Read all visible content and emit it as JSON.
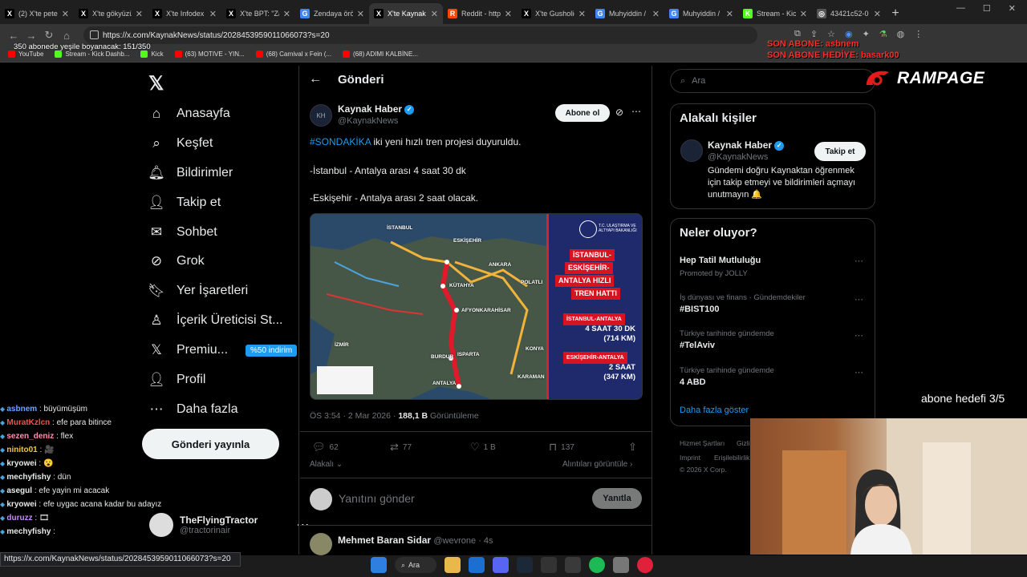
{
  "browser": {
    "tabs": [
      {
        "label": "(2) X'te peter",
        "fav": "X",
        "color": "#000000"
      },
      {
        "label": "X'te gökyüzü",
        "fav": "X",
        "color": "#000000"
      },
      {
        "label": "X'te Infodex",
        "fav": "X",
        "color": "#000000"
      },
      {
        "label": "X'te BPT: \"Za",
        "fav": "X",
        "color": "#000000"
      },
      {
        "label": "Zendaya örö",
        "fav": "G",
        "color": "#4285f4"
      },
      {
        "label": "X'te Kaynak",
        "fav": "X",
        "color": "#000000",
        "active": true
      },
      {
        "label": "Reddit - http",
        "fav": "R",
        "color": "#ff4500"
      },
      {
        "label": "X'te Gusholic",
        "fav": "X",
        "color": "#000000"
      },
      {
        "label": "Muhyiddin /",
        "fav": "G",
        "color": "#4285f4"
      },
      {
        "label": "Muhyiddin /",
        "fav": "G",
        "color": "#4285f4"
      },
      {
        "label": "Stream - Kick",
        "fav": "K",
        "color": "#53fc18"
      },
      {
        "label": "43421c52-0",
        "fav": "◎",
        "color": "#555555"
      }
    ],
    "new_tab": "+",
    "url": "https://x.com/KaynakNews/status/2028453959011066073?s=20",
    "bookmarks": [
      {
        "label": "YouTube",
        "color": "#ff0000"
      },
      {
        "label": "Stream - Kick Dashb...",
        "color": "#53fc18"
      },
      {
        "label": "Kick",
        "color": "#53fc18"
      },
      {
        "label": "(63) MOTIVE - YIN...",
        "color": "#ff0000"
      },
      {
        "label": "(68) Carnival x Fein (...",
        "color": "#ff0000"
      },
      {
        "label": "(68) ADIMI KALBİNE...",
        "color": "#ff0000"
      }
    ]
  },
  "overlay": {
    "sub_progress": "350 abonede yeşile boyanacak: 151/350",
    "last_sub": "SON ABONE: asbnem",
    "last_gift": "SON ABONE HEDİYE: basark00",
    "goal": "abone hedefi 3/5",
    "rampage": "RAMPAGE"
  },
  "nav": {
    "items": [
      {
        "label": "Anasayfa",
        "icon": "⌂",
        "name": "home"
      },
      {
        "label": "Keşfet",
        "icon": "⌕",
        "name": "explore"
      },
      {
        "label": "Bildirimler",
        "icon": "🔔︎",
        "name": "notifications"
      },
      {
        "label": "Takip et",
        "icon": "👤︎",
        "name": "follow"
      },
      {
        "label": "Sohbet",
        "icon": "✉",
        "name": "chat"
      },
      {
        "label": "Grok",
        "icon": "⊘",
        "name": "grok"
      },
      {
        "label": "Yer İşaretleri",
        "icon": "🔖︎",
        "name": "bookmarks"
      },
      {
        "label": "İçerik Üreticisi St...",
        "icon": "♙",
        "name": "creator-studio"
      },
      {
        "label": "Premiu...",
        "icon": "𝕏",
        "name": "premium"
      },
      {
        "label": "Profil",
        "icon": "👤︎",
        "name": "profile"
      },
      {
        "label": "Daha fazla",
        "icon": "⋯",
        "name": "more"
      }
    ],
    "premium_badge": "%50 indirim",
    "post_button": "Gönderi yayınla",
    "account_name": "TheFlyingTractor",
    "account_handle": "@tractorinair"
  },
  "post": {
    "header": "Gönderi",
    "author": "Kaynak Haber",
    "handle": "@KaynakNews",
    "follow": "Abone ol",
    "hashtag": "#SONDAKİKA",
    "line1": " iki yeni hızlı tren projesi duyuruldu.",
    "line2": "-İstanbul - Antalya arası 4 saat 30 dk",
    "line3": "-Eskişehir - Antalya arası 2 saat olacak.",
    "time": "ÖS 3:54 · 2 Mar 2026 · ",
    "views": "188,1 B",
    "views_label": " Görüntüleme",
    "replies": "62",
    "reposts": "77",
    "likes": "1 B",
    "bookmarks": "137",
    "relevance": "Alakalı",
    "quotes": "Alıntıları görüntüle",
    "reply_placeholder": "Yanıtını gönder",
    "reply_button": "Yanıtla",
    "next_author": "Mehmet Baran Sidar",
    "next_handle": "@wevrone · 4s",
    "image": {
      "ministry": "T.C. ULAŞTIRMA VE ALTYAPI BAKANLIĞI",
      "title1": "İSTANBUL-",
      "title2": "ESKİŞEHİR-",
      "title3": "ANTALYA HIZLI",
      "title4": "TREN HATTI",
      "tag1": "İSTANBUL-ANTALYA",
      "val1a": "4 SAAT 30 DK",
      "val1b": "(714 KM)",
      "tag2": "ESKİŞEHİR-ANTALYA",
      "val2a": "2 SAAT",
      "val2b": "(347 KM)",
      "cities": [
        "İSTANBUL",
        "ESKİŞEHİR",
        "ANKARA",
        "KÜTAHYA",
        "AFYONKARAHİSAR",
        "BURDUR",
        "ISPARTA",
        "ANTALYA",
        "İZMİR",
        "KONYA",
        "KARAMAN",
        "POLATLI"
      ]
    }
  },
  "right": {
    "search_placeholder": "Ara",
    "related_title": "Alakalı kişiler",
    "related_name": "Kaynak Haber",
    "related_handle": "@KaynakNews",
    "related_follow": "Takip et",
    "related_bio1": "Gündemi doğru Kaynaktan öğrenmek",
    "related_bio2": "için takip etmeyi ve bildirimleri açmayı",
    "related_bio3": "unutmayın 🔔",
    "trends_title": "Neler oluyor?",
    "trends": [
      {
        "ctx": "",
        "name": "Hep Tatil Mutluluğu",
        "extra": "Promoted by JOLLY"
      },
      {
        "ctx": "İş dünyası ve finans · Gündemdekiler",
        "name": "#BIST100",
        "extra": ""
      },
      {
        "ctx": "Türkiye tarihinde gündemde",
        "name": "#TelAviv",
        "extra": ""
      },
      {
        "ctx": "Türkiye tarihinde gündemde",
        "name": "4 ABD",
        "extra": ""
      }
    ],
    "show_more": "Daha fazla göster",
    "footer1": "Hizmet Şartları",
    "footer2": "Gizli",
    "footer3": "Imprint",
    "footer4": "Erişilebilirlik",
    "footer5": "© 2026 X Corp."
  },
  "chat": [
    {
      "user": "asbnem",
      "msg": " : büyümüşüm",
      "color": "#6aa6ff"
    },
    {
      "user": "MuratKzlcn",
      "msg": " : efe para bitince",
      "color": "#ff4d4d"
    },
    {
      "user": "sezen_deniz",
      "msg": " : flex",
      "color": "#ff8fb0"
    },
    {
      "user": "ninito01",
      "msg": " : 🎥",
      "color": "#f2c744"
    },
    {
      "user": "kryowei",
      "msg": " : 😮",
      "color": "#e7e9ea"
    },
    {
      "user": "mechyfishy",
      "msg": " : dün",
      "color": "#e7e9ea"
    },
    {
      "user": "asegul",
      "msg": " : efe yayin mi acacak",
      "color": "#e7e9ea"
    },
    {
      "user": "kryowei",
      "msg": " : efe uygac acana kadar bu adayız",
      "color": "#e7e9ea"
    },
    {
      "user": "duruzz",
      "msg": " : 🎞",
      "color": "#c586ff"
    },
    {
      "user": "mechyfishy",
      "msg": " : ",
      "color": "#e7e9ea"
    }
  ],
  "status_url": "https://x.com/KaynakNews/status/2028453959011066073?s=20",
  "taskbar": {
    "search": "Ara"
  }
}
